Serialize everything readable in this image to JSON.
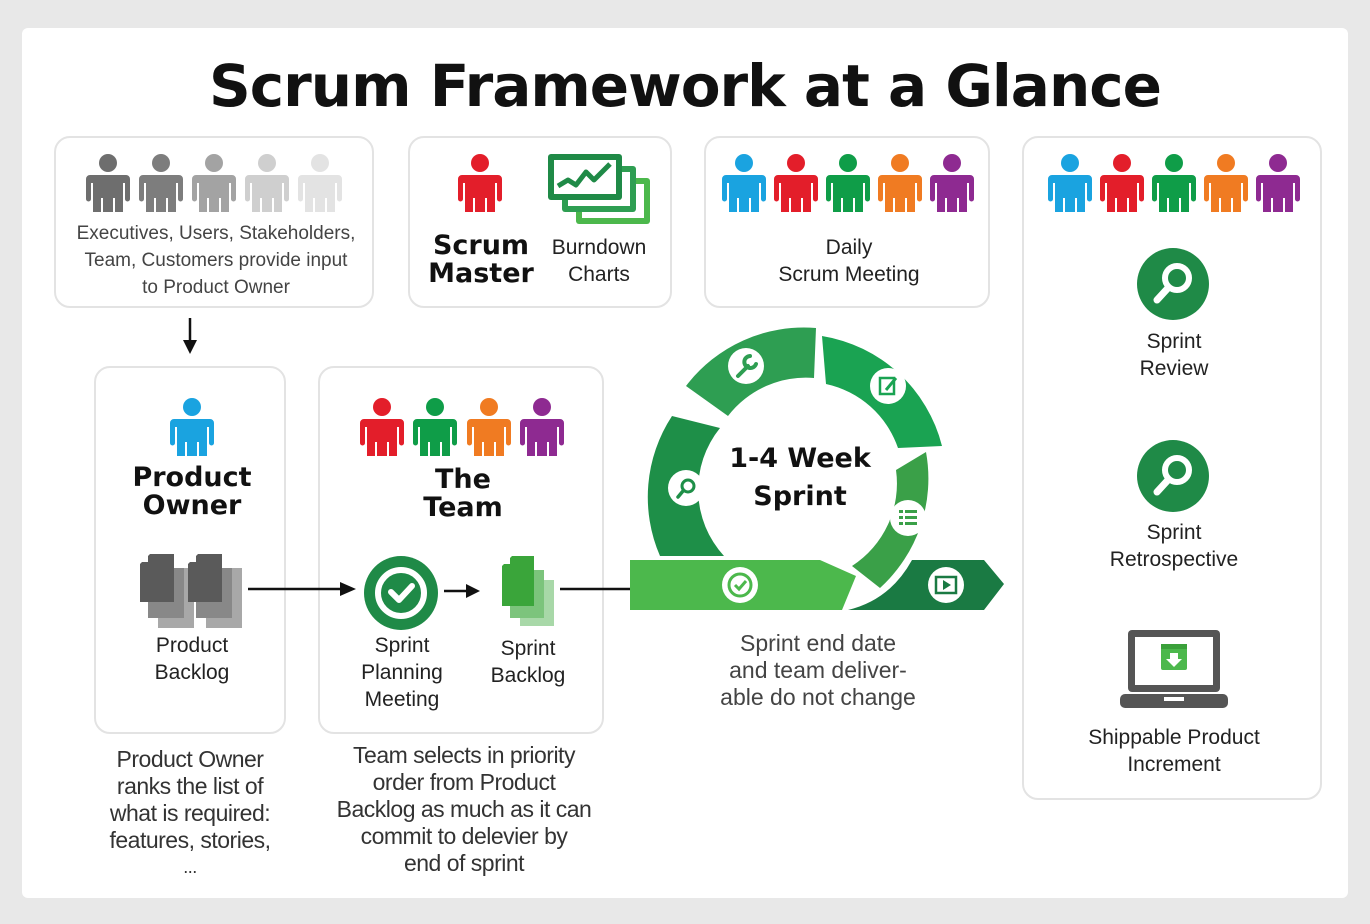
{
  "title": "Scrum Framework at a Glance",
  "colors": {
    "blue": "#1aa3e0",
    "red": "#e31e2a",
    "green": "#0f9d48",
    "orange": "#f07b22",
    "purple": "#8e2a91",
    "dark_green": "#1a7a43",
    "mid_green": "#2e9e52",
    "light_green": "#4cb84c"
  },
  "stakeholders": {
    "text": "Executives, Users, Stakeholders, Team, Customers provide input to Product Owner",
    "line1": "Executives, Users, Stakeholders,",
    "line2": "Team, Customers provide input",
    "line3": "to Product Owner"
  },
  "scrum_master": {
    "line1": "Scrum",
    "line2": "Master"
  },
  "burndown": {
    "line1": "Burndown",
    "line2": "Charts"
  },
  "daily_scrum": {
    "line1": "Daily",
    "line2": "Scrum Meeting"
  },
  "product_owner": {
    "line1": "Product",
    "line2": "Owner",
    "backlog_line1": "Product",
    "backlog_line2": "Backlog",
    "description": [
      "Product Owner",
      "ranks the list of",
      "what is required:",
      "features, stories,",
      "..."
    ]
  },
  "team": {
    "line1": "The",
    "line2": "Team",
    "planning_line1": "Sprint",
    "planning_line2": "Planning",
    "planning_line3": "Meeting",
    "backlog_line1": "Sprint",
    "backlog_line2": "Backlog",
    "description": [
      "Team selects in priority",
      "order from Product",
      "Backlog as much as it can",
      "commit to delevier by",
      "end of sprint"
    ]
  },
  "sprint": {
    "line1": "1-4 Week",
    "line2": "Sprint",
    "note": [
      "Sprint end date",
      "and team deliver-",
      "able do not change"
    ],
    "segment_icons": [
      "wrench-icon",
      "edit-icon",
      "list-icon",
      "play-icon",
      "check-icon",
      "search-icon"
    ]
  },
  "right_panel": {
    "review_line1": "Sprint",
    "review_line2": "Review",
    "retro_line1": "Sprint",
    "retro_line2": "Retrospective",
    "increment_line1": "Shippable Product",
    "increment_line2": "Increment"
  }
}
